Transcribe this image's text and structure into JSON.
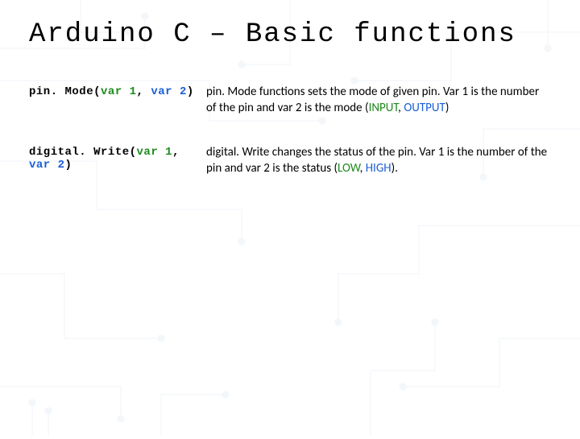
{
  "title": "Arduino C – Basic functions",
  "rows": [
    {
      "fn": "pin. Mode",
      "var1": "var 1",
      "var2": "var 2",
      "desc_pre": "pin. Mode functions sets the mode of given pin. Var 1 is the number of the pin and var 2 is the mode (",
      "kw1": "INPUT",
      "sep": ", ",
      "kw2": "OUTPUT",
      "desc_post": ")"
    },
    {
      "fn": "digital. Write",
      "var1": "var 1",
      "var2": "var 2",
      "desc_pre": "digital. Write changes the status of the pin. Var 1 is the number of the pin and var 2 is the status (",
      "kw1": "LOW",
      "sep": ", ",
      "kw2": "HIGH",
      "desc_post": ")."
    }
  ]
}
